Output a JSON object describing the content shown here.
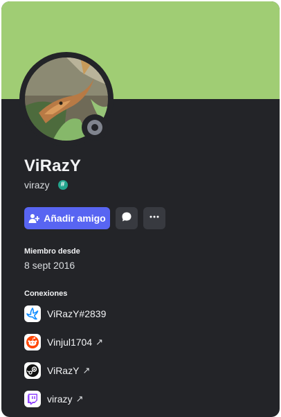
{
  "profile": {
    "display_name": "ViRazY",
    "username": "virazy",
    "tag_symbol": "#",
    "banner_color": "#a0cd74",
    "status": "offline"
  },
  "actions": {
    "add_friend_label": "Añadir amigo",
    "message_icon": "chat-bubble-icon",
    "more_icon": "ellipsis-icon"
  },
  "member_since": {
    "title": "Miembro desde",
    "date": "8 sept 2016"
  },
  "connections": {
    "title": "Conexiones",
    "items": [
      {
        "service": "battlenet",
        "label": "ViRazY#2839",
        "external_arrow": ""
      },
      {
        "service": "reddit",
        "label": "Vinjul1704",
        "external_arrow": "↗"
      },
      {
        "service": "steam",
        "label": "ViRazY",
        "external_arrow": "↗"
      },
      {
        "service": "twitch",
        "label": "virazy",
        "external_arrow": "↗"
      }
    ]
  }
}
